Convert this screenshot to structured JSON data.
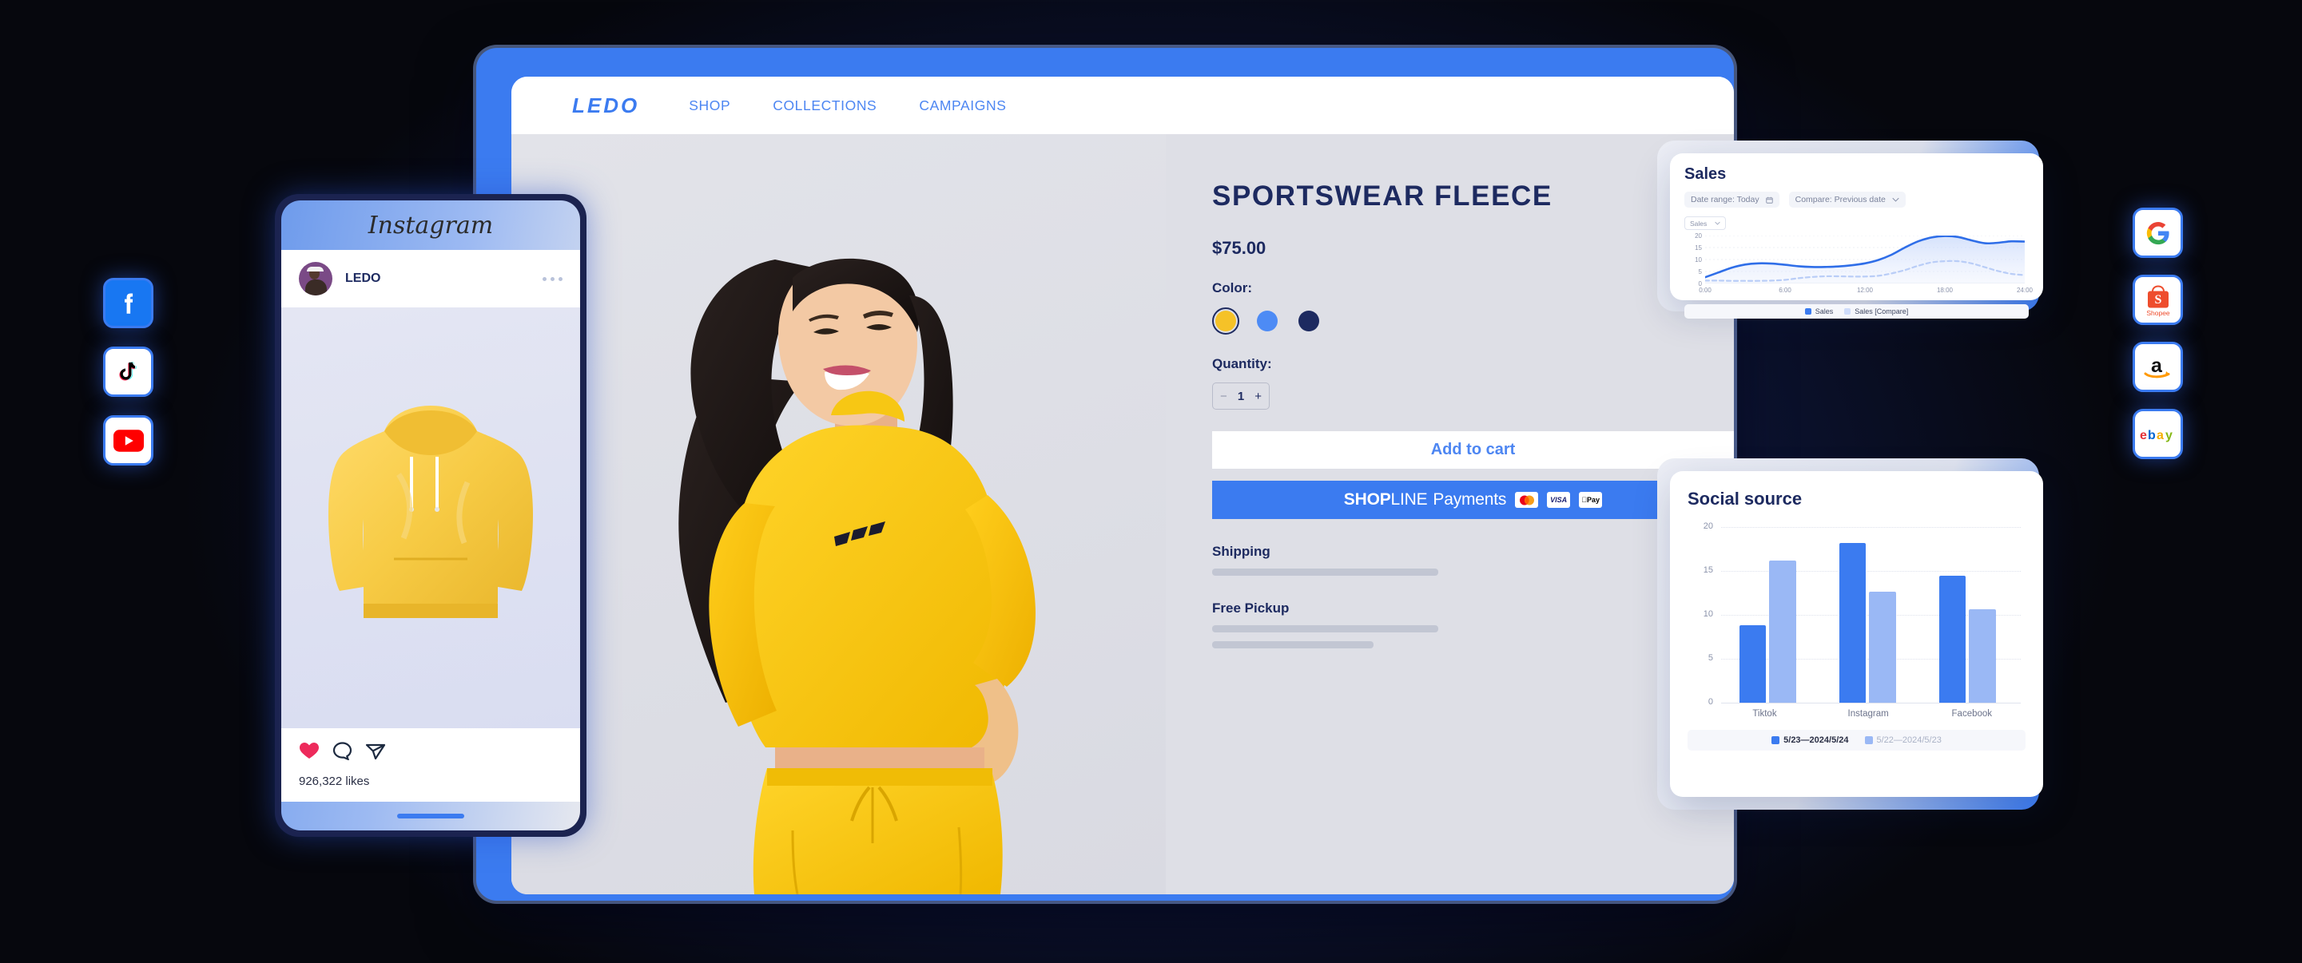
{
  "background": {
    "color": "#06070d",
    "glow": "#1b2a63"
  },
  "theme": {
    "brand_blue": "#3b7bf0",
    "navy": "#1d2a60",
    "light_blue": "#9ab8f5",
    "yellow": "#f5c228"
  },
  "social_rail_left": [
    {
      "name": "facebook-icon",
      "label": "Facebook"
    },
    {
      "name": "tiktok-icon",
      "label": "TikTok"
    },
    {
      "name": "youtube-icon",
      "label": "YouTube"
    }
  ],
  "marketplace_rail_right": [
    {
      "name": "google-icon",
      "label": "Google"
    },
    {
      "name": "shopee-icon",
      "label": "Shopee"
    },
    {
      "name": "amazon-icon",
      "label": "Amazon"
    },
    {
      "name": "ebay-icon",
      "label": "eBay"
    }
  ],
  "storefront": {
    "logo": "LEDO",
    "nav": [
      {
        "label": "SHOP"
      },
      {
        "label": "COLLECTIONS"
      },
      {
        "label": "CAMPAIGNS"
      }
    ],
    "product": {
      "title": "SPORTSWEAR  FLEECE",
      "price": "$75.00",
      "color_label": "Color:",
      "colors": [
        {
          "name": "yellow",
          "hex": "#f5c228",
          "selected": true
        },
        {
          "name": "blue",
          "hex": "#4d8bf5",
          "selected": false
        },
        {
          "name": "navy",
          "hex": "#1d2a60",
          "selected": false
        }
      ],
      "quantity_label": "Quantity:",
      "quantity_value": "1",
      "quantity_minus": "−",
      "quantity_plus": "+",
      "add_to_cart": "Add to cart",
      "payments": {
        "brand_bold": "SHOP",
        "brand_thin": "LINE",
        "brand_suffix": "Payments",
        "cards": [
          {
            "name": "mastercard-logo",
            "label": "MC"
          },
          {
            "name": "visa-logo",
            "label": "VISA"
          },
          {
            "name": "apple-pay-logo",
            "label": "Pay"
          }
        ]
      },
      "shipping_label": "Shipping",
      "pickup_label": "Free Pickup"
    }
  },
  "instagram": {
    "wordmark": "Instagram",
    "account_name": "LEDO",
    "more_icon": "ellipsis-icon",
    "actions": [
      {
        "name": "heart-icon"
      },
      {
        "name": "comment-icon"
      },
      {
        "name": "share-icon"
      }
    ],
    "likes": "926,322 likes"
  },
  "sales_panel": {
    "title": "Sales",
    "date_range": "Date range: Today",
    "calendar_icon": "calendar-icon",
    "compare": "Compare: Previous date",
    "chevron_icon": "chevron-down-icon",
    "metric_select": "Sales"
  },
  "social_panel": {
    "title": "Social source"
  },
  "chart_data": [
    {
      "type": "area",
      "title": "Sales",
      "xlabel": "",
      "ylabel": "",
      "ylim": [
        0,
        20
      ],
      "yticks": [
        0,
        5,
        10,
        15,
        20
      ],
      "x": [
        "0:00",
        "6:00",
        "12:00",
        "18:00",
        "24:00"
      ],
      "xticks": [
        "0:00",
        "6:00",
        "12:00",
        "18:00",
        "24:00"
      ],
      "grid": true,
      "legend_position": "bottom",
      "series": [
        {
          "name": "Sales",
          "color": "#2f6ee8",
          "style": "solid",
          "x": [
            0,
            1,
            2,
            3,
            4,
            5,
            6,
            7,
            8,
            9,
            10,
            11,
            12,
            13,
            14,
            15,
            16,
            17,
            18,
            19,
            20,
            21,
            22,
            23,
            24
          ],
          "values": [
            2.6,
            4.6,
            6.6,
            7.9,
            8.4,
            8.3,
            7.8,
            7.2,
            6.9,
            6.9,
            7.1,
            7.6,
            8.4,
            9.8,
            12.0,
            15.0,
            17.6,
            19.2,
            19.8,
            19.4,
            18.0,
            16.8,
            17.0,
            17.6,
            17.5
          ]
        },
        {
          "name": "Sales [Compare]",
          "color": "#b9cdf7",
          "style": "dashed",
          "x": [
            0,
            1,
            2,
            3,
            4,
            5,
            6,
            7,
            8,
            9,
            10,
            11,
            12,
            13,
            14,
            15,
            16,
            17,
            18,
            19,
            20,
            21,
            22,
            23,
            24
          ],
          "values": [
            1.2,
            1.2,
            1.1,
            1.1,
            1.1,
            1.2,
            1.5,
            2.2,
            2.7,
            3.0,
            3.0,
            2.9,
            2.9,
            3.2,
            4.2,
            5.6,
            7.4,
            8.8,
            9.3,
            9.3,
            8.4,
            6.8,
            5.2,
            4.0,
            3.5
          ]
        }
      ]
    },
    {
      "type": "bar",
      "title": "Social source",
      "xlabel": "",
      "ylabel": "",
      "ylim": [
        0,
        20
      ],
      "yticks": [
        0,
        5,
        10,
        15,
        20
      ],
      "categories": [
        "Tiktok",
        "Instagram",
        "Facebook"
      ],
      "grid": true,
      "legend_position": "bottom",
      "series": [
        {
          "name": "5/23—2024/5/24",
          "color": "#3b7bf0",
          "values": [
            8.8,
            18.2,
            14.5
          ]
        },
        {
          "name": "5/22—2024/5/23",
          "color": "#9ab8f5",
          "values": [
            16.2,
            12.6,
            10.6
          ]
        }
      ]
    }
  ]
}
